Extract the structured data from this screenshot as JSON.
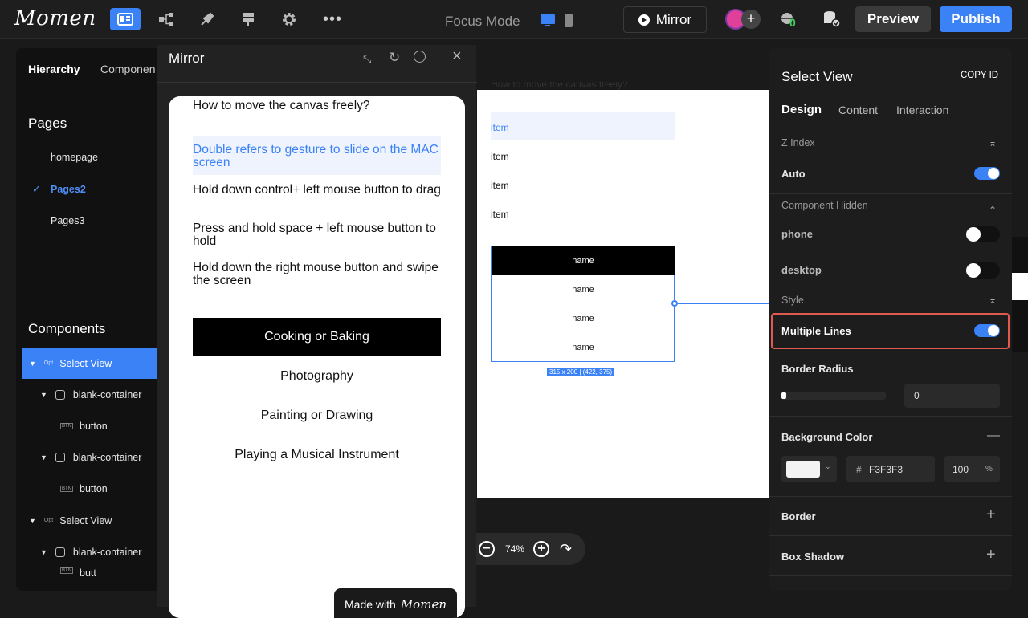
{
  "topbar": {
    "logo": "Momen",
    "focus_mode": "Focus Mode",
    "mirror": "Mirror",
    "badge_count": "0",
    "preview": "Preview",
    "publish": "Publish"
  },
  "left": {
    "tabs": [
      "Hierarchy",
      "Componen"
    ],
    "pages_title": "Pages",
    "pages": [
      {
        "label": "homepage",
        "selected": false
      },
      {
        "label": "Pages2",
        "selected": true
      },
      {
        "label": "Pages3",
        "selected": false
      }
    ],
    "components_title": "Components",
    "components": [
      {
        "label": "Select View",
        "tag": "Opt",
        "level": 0,
        "selected": true
      },
      {
        "label": "blank-container",
        "tag": "box",
        "level": 1
      },
      {
        "label": "button",
        "tag": "BTN",
        "level": 2
      },
      {
        "label": "blank-container",
        "tag": "box",
        "level": 1
      },
      {
        "label": "button",
        "tag": "BTN",
        "level": 2
      },
      {
        "label": "Select View",
        "tag": "Opt",
        "level": 0
      },
      {
        "label": "blank-container",
        "tag": "box",
        "level": 1
      },
      {
        "label": "butt",
        "tag": "BTN",
        "level": 2
      }
    ]
  },
  "mirror": {
    "title": "Mirror",
    "heading": "How to move the canvas freely?",
    "tips": [
      "Double refers to gesture to slide on the MAC screen",
      "Hold down control+ left mouse button to drag",
      "Press and hold space + left mouse button to hold",
      "Hold down the right mouse button and swipe the screen"
    ],
    "options": [
      "Cooking or Baking",
      "Photography",
      "Painting or Drawing",
      "Playing a Musical Instrument"
    ],
    "made_with": "Made with",
    "made_with_brand": "Momen"
  },
  "canvas": {
    "heading": "How to move the canvas freely?",
    "items": [
      "item",
      "item",
      "item",
      "item"
    ],
    "select_rows": [
      "name",
      "name",
      "name",
      "name"
    ],
    "size_label": "315 x 200 | (422, 375)",
    "zoom": "74%"
  },
  "right": {
    "title": "Select View",
    "copy_id": "COPY ID",
    "tabs": [
      "Design",
      "Content",
      "Interaction"
    ],
    "z_index_label": "Z Index",
    "auto_label": "Auto",
    "auto_on": true,
    "component_hidden_label": "Component Hidden",
    "phone_label": "phone",
    "phone_on": false,
    "desktop_label": "desktop",
    "desktop_on": false,
    "style_label": "Style",
    "multiple_lines_label": "Multiple Lines",
    "multiple_lines_on": true,
    "border_radius_label": "Border Radius",
    "border_radius_value": "0",
    "background_color_label": "Background Color",
    "bg_hash": "#",
    "bg_hex": "F3F3F3",
    "bg_opacity": "100",
    "bg_percent": "%",
    "border_label": "Border",
    "box_shadow_label": "Box Shadow"
  },
  "colors": {
    "accent": "#3b82f6",
    "highlight_outline": "#e05a4f",
    "bg_swatch": "#F3F3F3"
  }
}
